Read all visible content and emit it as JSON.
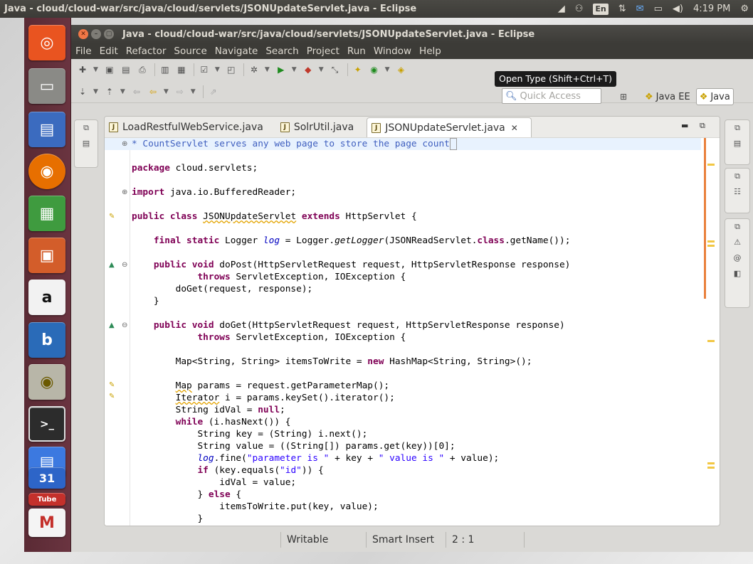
{
  "top_panel": {
    "title": "Java - cloud/cloud-war/src/java/cloud/servlets/JSONUpdateServlet.java - Eclipse",
    "keyboard_layout": "En",
    "clock": "4:19 PM",
    "icons": [
      "network-icon",
      "accessibility-icon",
      "keyboard-icon",
      "transfer-icon",
      "mail-icon",
      "battery-icon",
      "volume-icon",
      "settings-icon"
    ]
  },
  "launcher": {
    "items": [
      "ubuntu-dash",
      "files",
      "document-viewer",
      "firefox",
      "libreoffice-calc",
      "libreoffice-impress",
      "amazon",
      "banshee",
      "rhythmbox",
      "terminal",
      "docs",
      "calendar",
      "youtube",
      "gmail"
    ],
    "amazon_letter": "a",
    "banshee_letter": "b",
    "calendar_day": "31",
    "youtube_label": "Tube",
    "terminal_prompt": ">_",
    "gmail_letter": "M"
  },
  "window": {
    "title": "Java - cloud/cloud-war/src/java/cloud/servlets/JSONUpdateServlet.java - Eclipse",
    "menu": [
      "File",
      "Edit",
      "Refactor",
      "Source",
      "Navigate",
      "Search",
      "Project",
      "Run",
      "Window",
      "Help"
    ],
    "tooltip": "Open Type (Shift+Ctrl+T)",
    "quick_access_placeholder": "Quick Access",
    "perspectives": [
      "Java EE",
      "Java"
    ]
  },
  "editor": {
    "tabs": [
      {
        "label": "LoadRestfulWebService.java",
        "active": false
      },
      {
        "label": "SolrUtil.java",
        "active": false
      },
      {
        "label": "JSONUpdateServlet.java",
        "active": true
      }
    ],
    "close_glyph": "✕"
  },
  "status": {
    "writable": "Writable",
    "insert_mode": "Smart Insert",
    "position": "2 : 1"
  },
  "colors": {
    "keyword": "#7f0055",
    "string": "#2a00ff",
    "comment": "#3f5fbf",
    "field": "#0000c0",
    "ubuntu_panel": "#3c3b37",
    "launcher": "#5a2a34"
  }
}
